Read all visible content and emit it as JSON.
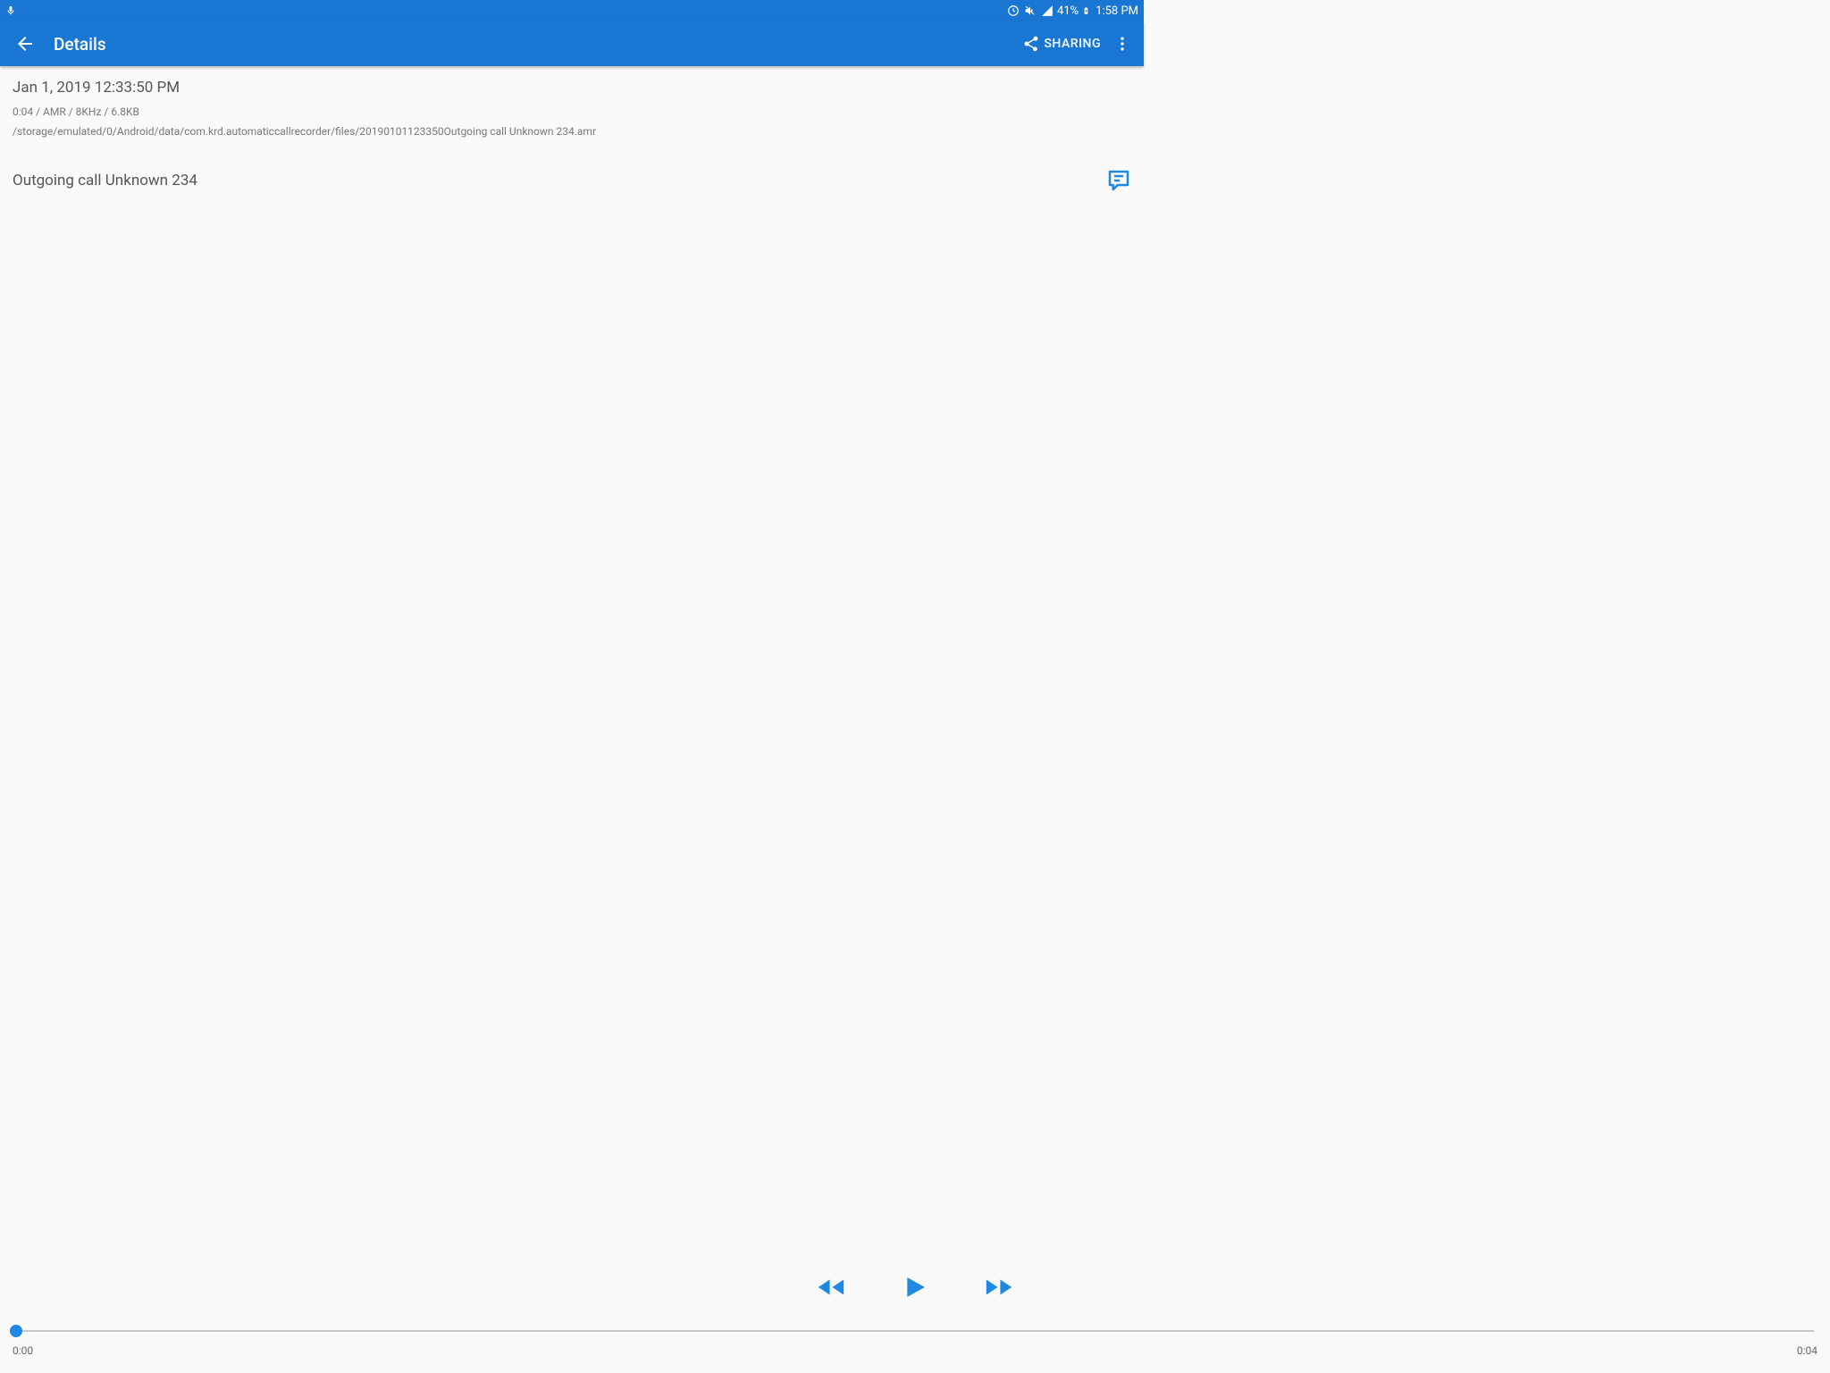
{
  "status": {
    "battery_pct": "41%",
    "clock": "1:58 PM"
  },
  "appbar": {
    "title": "Details",
    "share_label": "SHARING"
  },
  "details": {
    "timestamp": "Jan 1, 2019 12:33:50 PM",
    "meta": "0:04 / AMR / 8KHz / 6.8KB",
    "filepath": "/storage/emulated/0/Android/data/com.krd.automaticcallrecorder/files/20190101123350Outgoing call Unknown 234.amr",
    "call_title": "Outgoing call Unknown 234"
  },
  "player": {
    "current": "0:00",
    "total": "0:04"
  }
}
